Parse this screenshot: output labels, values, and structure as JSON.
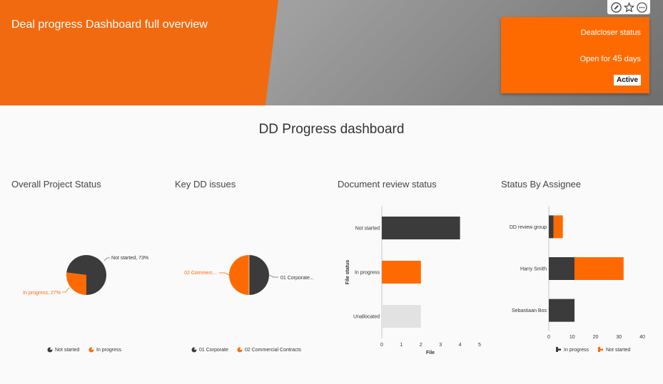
{
  "header": {
    "title": "Deal progress Dashboard full overview"
  },
  "status_card": {
    "title": "Dealcloser status",
    "open_prefix": "Open for",
    "open_days": "45",
    "open_suffix": "days",
    "badge": "Active"
  },
  "toolbar": {
    "edit_icon": "pencil-icon",
    "favorite_icon": "star-icon",
    "more_icon": "more-icon"
  },
  "dashboard": {
    "title": "DD Progress dashboard"
  },
  "colors": {
    "orange": "#ff6a00",
    "dark": "#3b3b3b",
    "light": "#e2e2e2"
  },
  "chart_data": [
    {
      "type": "pie",
      "title": "Overall Project Status",
      "slices": [
        {
          "label": "Not started",
          "value": 73,
          "callout": "Not started, 73%",
          "color": "#3b3b3b"
        },
        {
          "label": "In progress",
          "value": 27,
          "callout": "In progress, 27%",
          "color": "#ff6a00"
        }
      ],
      "legend": [
        "Not started",
        "In progress"
      ]
    },
    {
      "type": "pie",
      "title": "Key DD issues",
      "slices": [
        {
          "label": "01 Corporate",
          "value": 50,
          "callout": "01 Corporate...",
          "color": "#3b3b3b"
        },
        {
          "label": "02 Commercial Contracts",
          "value": 50,
          "callout": "02 Commerc...",
          "color": "#ff6a00"
        }
      ],
      "legend": [
        "01 Corporate",
        "02 Commercial Contracts"
      ]
    },
    {
      "type": "bar",
      "orientation": "horizontal",
      "title": "Document review status",
      "categories": [
        "Not started",
        "In progress",
        "Unallocated"
      ],
      "values": [
        4,
        2,
        2
      ],
      "colors": [
        "#3b3b3b",
        "#ff6a00",
        "#e2e2e2"
      ],
      "xlabel": "File",
      "ylabel": "File status",
      "xlim": [
        0,
        5
      ],
      "xticks": [
        0,
        1,
        2,
        3,
        4,
        5
      ]
    },
    {
      "type": "bar",
      "orientation": "horizontal",
      "stacked": true,
      "title": "Status By Assignee",
      "categories": [
        "DD review group",
        "Harry Smith",
        "Sebastiaan Bos"
      ],
      "series": [
        {
          "name": "In progress",
          "values": [
            2,
            11,
            11
          ],
          "color": "#3b3b3b"
        },
        {
          "name": "Not started",
          "values": [
            4,
            21,
            0
          ],
          "color": "#ff6a00"
        }
      ],
      "xlim": [
        0,
        40
      ],
      "xticks": [
        0,
        10,
        20,
        30,
        40
      ]
    }
  ]
}
